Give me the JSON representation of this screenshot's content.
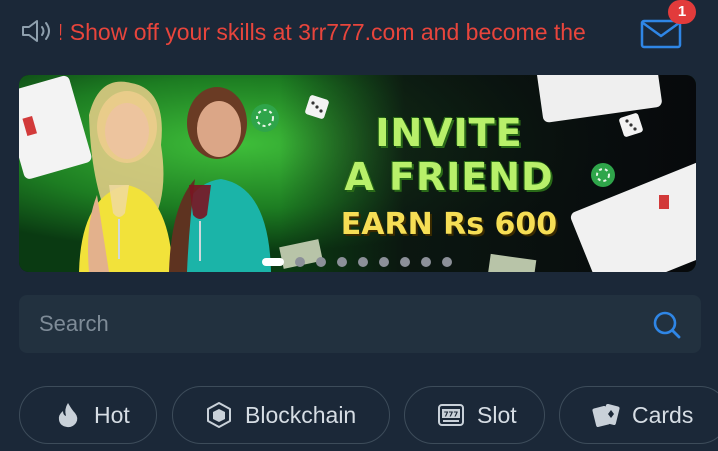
{
  "notice": {
    "icon": "speaker-icon",
    "text": "! Show off your skills at 3rr777.com and become the"
  },
  "inbox": {
    "icon": "mail-icon",
    "badge": "1",
    "badge_color": "#e23b3b"
  },
  "banner": {
    "title_line1": "INVITE",
    "title_line2": "A FRIEND",
    "subtitle": "EARN Rs 600",
    "slides_total": 9,
    "active_slide": 1
  },
  "search": {
    "placeholder": "Search",
    "value": "",
    "icon": "search-icon",
    "icon_color": "#2f86e6"
  },
  "categories": [
    {
      "label": "Hot",
      "icon": "flame-icon"
    },
    {
      "label": "Blockchain",
      "icon": "cube-icon"
    },
    {
      "label": "Slot",
      "icon": "slot-machine-icon"
    },
    {
      "label": "Cards",
      "icon": "cards-icon"
    }
  ],
  "colors": {
    "background": "#1b2838",
    "notice_text": "#e8453c",
    "accent_blue": "#2f86e6"
  }
}
